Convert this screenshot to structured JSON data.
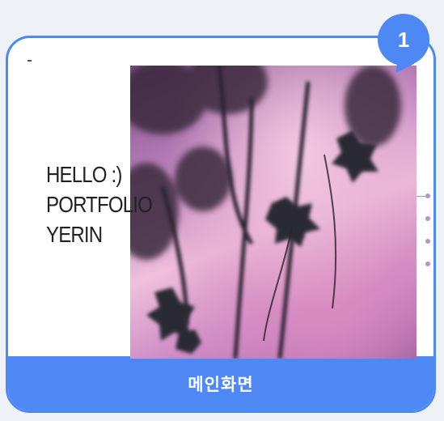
{
  "badge": {
    "number": "1"
  },
  "hero": {
    "lines": [
      "HELLO :)",
      "PORTFOLIO",
      "YERIN"
    ]
  },
  "photo": {
    "description_icon": "flower-photo"
  },
  "side_nav": {
    "dots": 4
  },
  "footer": {
    "label": "메인화면"
  },
  "colors": {
    "accent": "#4e88f5",
    "background": "#eef1f6",
    "nav": "#b993c4"
  }
}
